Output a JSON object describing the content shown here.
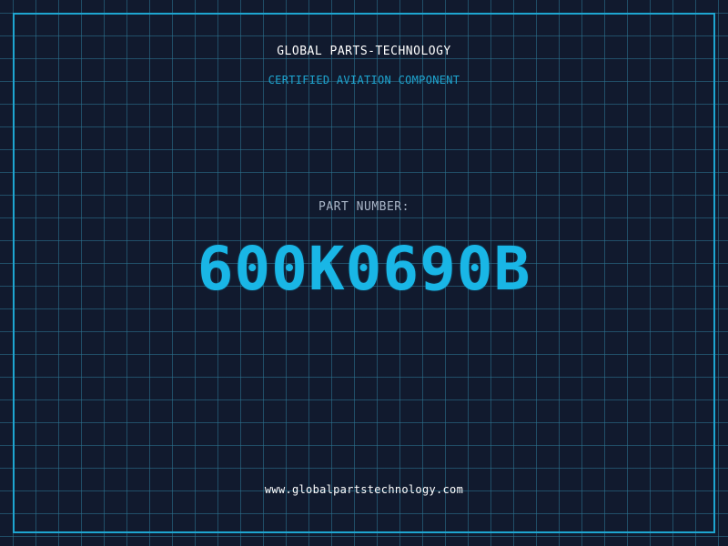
{
  "brand": "GLOBAL PARTS-TECHNOLOGY",
  "tagline": "CERTIFIED AVIATION COMPONENT",
  "part": {
    "label": "PART NUMBER:",
    "number": "600K0690B"
  },
  "website": "www.globalpartstechnology.com",
  "colors": {
    "background": "#111a2e",
    "accent": "#19b6e6",
    "frame": "#1ea5d0"
  }
}
